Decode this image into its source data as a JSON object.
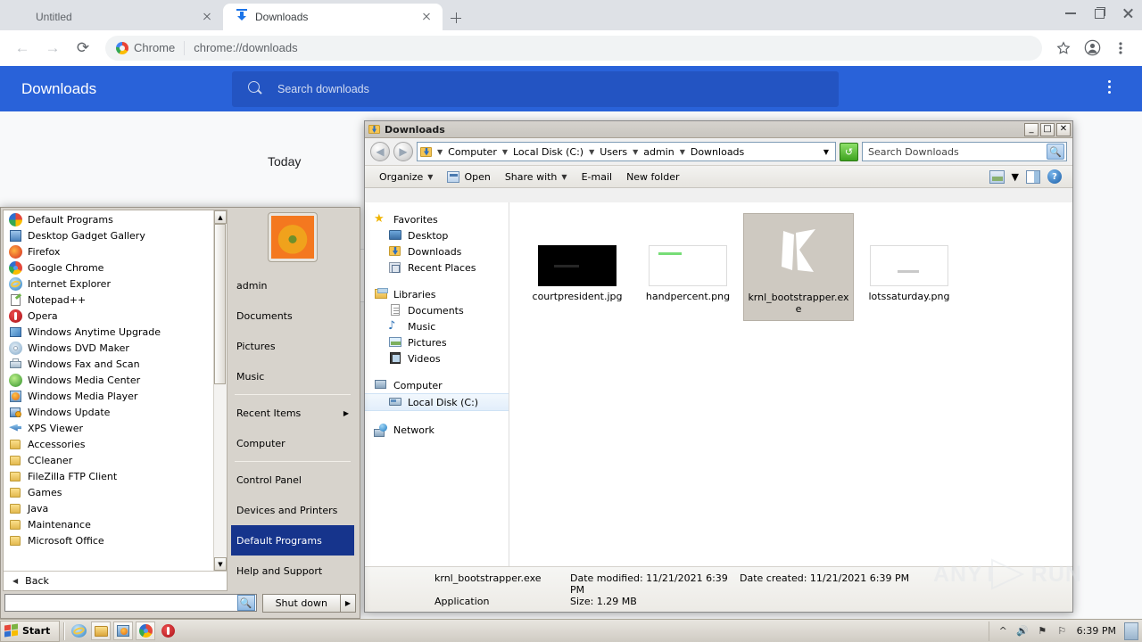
{
  "browser": {
    "tabs": [
      {
        "title": "Untitled",
        "favicon": "none",
        "active": false
      },
      {
        "title": "Downloads",
        "favicon": "download-icon",
        "active": true
      }
    ],
    "new_tab_label": "+",
    "window_controls": [
      "minimize",
      "restore",
      "close"
    ],
    "toolbar": {
      "back": "←",
      "forward": "→",
      "reload": "⟳",
      "site_chip": "Chrome",
      "url": "chrome://downloads",
      "bookmark_icon": "star-icon",
      "profile_icon": "account-icon",
      "menu_icon": "three-dot-menu-icon"
    }
  },
  "downloads_page": {
    "title": "Downloads",
    "search_placeholder": "Search downloads",
    "menu_icon": "three-dot-menu-icon",
    "section_label": "Today",
    "accent_color": "#2962d9"
  },
  "explorer": {
    "window_title": "Downloads",
    "window_controls": {
      "minimize": "_",
      "maximize": "□",
      "close": "✕"
    },
    "nav": {
      "back": "◀",
      "forward": "▶"
    },
    "breadcrumbs": [
      "Computer",
      "Local Disk (C:)",
      "Users",
      "admin",
      "Downloads"
    ],
    "refresh_icon": "refresh-icon",
    "search_placeholder": "Search Downloads",
    "commands": [
      {
        "label": "Organize",
        "caret": true
      },
      {
        "label": "Open",
        "caret": false
      },
      {
        "label": "Share with",
        "caret": true
      },
      {
        "label": "E-mail",
        "caret": false
      },
      {
        "label": "New folder",
        "caret": false
      }
    ],
    "command_right_icons": [
      "view-layout-icon",
      "view-dropdown-caret",
      "preview-pane-icon",
      "help-icon"
    ],
    "sidebar": [
      {
        "label": "Favorites",
        "icon": "star-icon",
        "level": 0
      },
      {
        "label": "Desktop",
        "icon": "desktop-icon",
        "level": 1
      },
      {
        "label": "Downloads",
        "icon": "downloads-folder-icon",
        "level": 1
      },
      {
        "label": "Recent Places",
        "icon": "recent-places-icon",
        "level": 1
      },
      {
        "label": "Libraries",
        "icon": "libraries-icon",
        "level": 0
      },
      {
        "label": "Documents",
        "icon": "document-icon",
        "level": 1
      },
      {
        "label": "Music",
        "icon": "music-note-icon",
        "level": 1
      },
      {
        "label": "Pictures",
        "icon": "picture-icon",
        "level": 1
      },
      {
        "label": "Videos",
        "icon": "video-icon",
        "level": 1
      },
      {
        "label": "Computer",
        "icon": "computer-icon",
        "level": 0
      },
      {
        "label": "Local Disk (C:)",
        "icon": "hard-disk-icon",
        "level": 1,
        "selected": true
      },
      {
        "label": "Network",
        "icon": "network-icon",
        "level": 0
      }
    ],
    "files": [
      {
        "name": "courtpresident.jpg",
        "thumb": "black-image",
        "selected": false
      },
      {
        "name": "handpercent.png",
        "thumb": "white-image-green-bar",
        "selected": false
      },
      {
        "name": "krnl_bootstrapper.exe",
        "thumb": "krnl-k-logo",
        "selected": true
      },
      {
        "name": "lotssaturday.png",
        "thumb": "white-image-gray-bar",
        "selected": false
      }
    ],
    "status": {
      "file_name": "krnl_bootstrapper.exe",
      "file_type": "Application",
      "date_modified_label": "Date modified:",
      "date_modified_value": "11/21/2021 6:39 PM",
      "size_label": "Size:",
      "size_value": "1.29 MB",
      "date_created_label": "Date created:",
      "date_created_value": "11/21/2021 6:39 PM"
    }
  },
  "start_menu": {
    "programs": [
      {
        "label": "Default Programs",
        "icon": "default-programs-icon",
        "type": "app"
      },
      {
        "label": "Desktop Gadget Gallery",
        "icon": "gadget-gallery-icon",
        "type": "app"
      },
      {
        "label": "Firefox",
        "icon": "firefox-icon",
        "type": "app"
      },
      {
        "label": "Google Chrome",
        "icon": "chrome-icon",
        "type": "app"
      },
      {
        "label": "Internet Explorer",
        "icon": "internet-explorer-icon",
        "type": "app"
      },
      {
        "label": "Notepad++",
        "icon": "notepad-plus-plus-icon",
        "type": "app"
      },
      {
        "label": "Opera",
        "icon": "opera-icon",
        "type": "app"
      },
      {
        "label": "Windows Anytime Upgrade",
        "icon": "windows-anytime-upgrade-icon",
        "type": "app"
      },
      {
        "label": "Windows DVD Maker",
        "icon": "windows-dvd-maker-icon",
        "type": "app"
      },
      {
        "label": "Windows Fax and Scan",
        "icon": "fax-and-scan-icon",
        "type": "app"
      },
      {
        "label": "Windows Media Center",
        "icon": "media-center-icon",
        "type": "app"
      },
      {
        "label": "Windows Media Player",
        "icon": "media-player-icon",
        "type": "app"
      },
      {
        "label": "Windows Update",
        "icon": "windows-update-icon",
        "type": "app"
      },
      {
        "label": "XPS Viewer",
        "icon": "xps-viewer-icon",
        "type": "app"
      },
      {
        "label": "Accessories",
        "icon": "folder-icon",
        "type": "folder"
      },
      {
        "label": "CCleaner",
        "icon": "folder-icon",
        "type": "folder"
      },
      {
        "label": "FileZilla FTP Client",
        "icon": "folder-icon",
        "type": "folder"
      },
      {
        "label": "Games",
        "icon": "folder-icon",
        "type": "folder"
      },
      {
        "label": "Java",
        "icon": "folder-icon",
        "type": "folder"
      },
      {
        "label": "Maintenance",
        "icon": "folder-icon",
        "type": "folder"
      },
      {
        "label": "Microsoft Office",
        "icon": "folder-icon",
        "type": "folder"
      }
    ],
    "back_label": "Back",
    "search_value": "",
    "user_name": "admin",
    "right_items": [
      {
        "label": "Documents",
        "arrow": false,
        "highlight": false
      },
      {
        "label": "Pictures",
        "arrow": false,
        "highlight": false
      },
      {
        "label": "Music",
        "arrow": false,
        "highlight": false
      },
      {
        "label": "Recent Items",
        "arrow": true,
        "highlight": false
      },
      {
        "label": "Computer",
        "arrow": false,
        "highlight": false
      },
      {
        "label": "Control Panel",
        "arrow": false,
        "highlight": false
      },
      {
        "label": "Devices and Printers",
        "arrow": false,
        "highlight": false
      },
      {
        "label": "Default Programs",
        "arrow": false,
        "highlight": true
      },
      {
        "label": "Help and Support",
        "arrow": false,
        "highlight": false
      }
    ],
    "shutdown_label": "Shut down",
    "shutdown_arrow": "▶"
  },
  "taskbar": {
    "start_label": "Start",
    "quick_launch": [
      "internet-explorer-icon",
      "windows-explorer-icon",
      "windows-media-player-icon",
      "google-chrome-icon",
      "opera-icon"
    ],
    "tray_icons": [
      "show-hidden-icons-chevron",
      "volume-icon",
      "action-center-warning-icon",
      "network-flag-icon"
    ],
    "clock": "6:39 PM",
    "show_desktop": "show-desktop-button"
  },
  "watermark": {
    "text_left": "ANY",
    "text_right": "RUN"
  }
}
